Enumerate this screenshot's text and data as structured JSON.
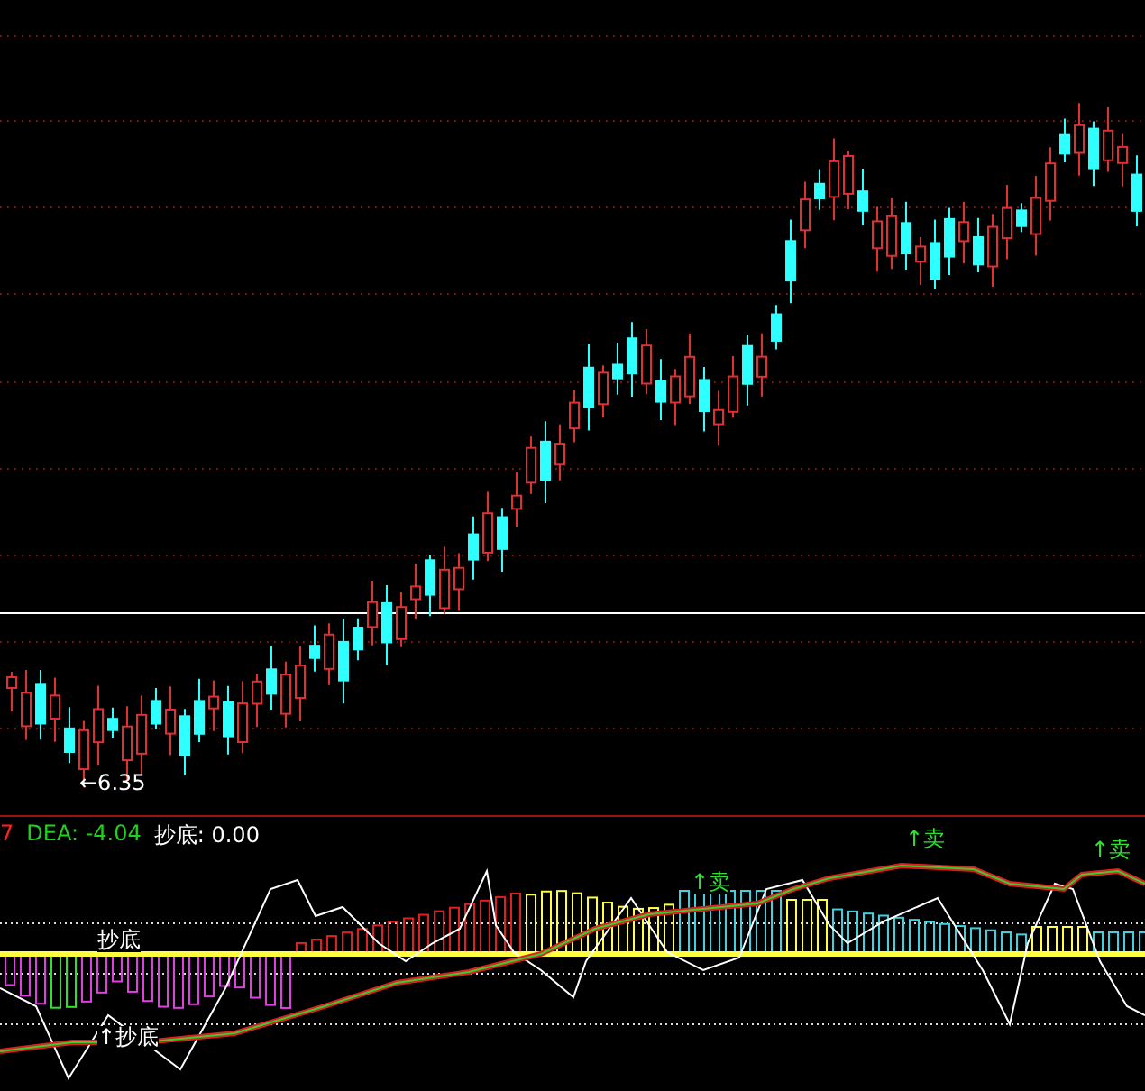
{
  "price_panel": {
    "low_marker": "←6.35"
  },
  "indicator_panel": {
    "legend": [
      {
        "label": "7",
        "color": "#ff2020"
      },
      {
        "label": "DEA: -4.04",
        "color": "#20d020"
      },
      {
        "label": "抄底: 0.00",
        "color": "#ffffff"
      }
    ],
    "signals": [
      {
        "kind": "buy",
        "text": "抄底"
      },
      {
        "kind": "buy",
        "text": "↑抄底"
      },
      {
        "kind": "sell",
        "text": "↑卖"
      },
      {
        "kind": "sell",
        "text": "↑卖"
      },
      {
        "kind": "sell",
        "text": "↑卖"
      }
    ]
  }
}
